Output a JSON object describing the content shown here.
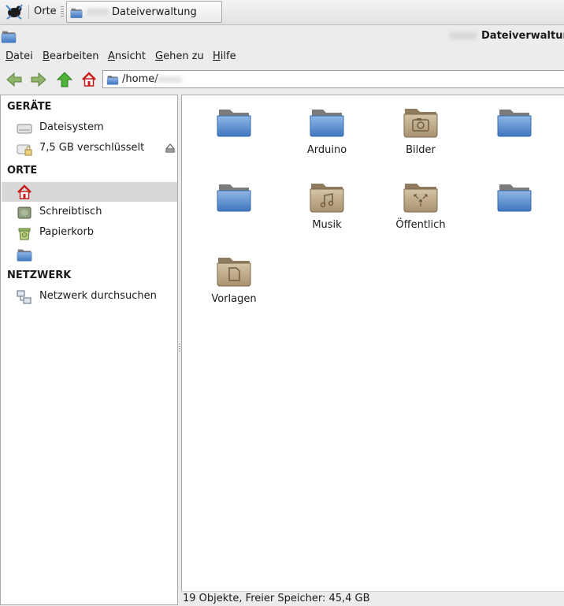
{
  "panel": {
    "places_label": "Orte",
    "task_title": "Dateiverwaltung"
  },
  "window": {
    "title": "Dateiverwaltun"
  },
  "menu": {
    "items": [
      "Datei",
      "Bearbeiten",
      "Ansicht",
      "Gehen zu",
      "Hilfe"
    ]
  },
  "toolbar": {
    "path": "/home/"
  },
  "sidebar": {
    "sections": {
      "devices": "GERÄTE",
      "places": "ORTE",
      "network": "NETZWERK"
    },
    "items": {
      "filesystem": "Dateisystem",
      "encrypted": "7,5 GB verschlüsselt",
      "home": "",
      "desktop": "Schreibtisch",
      "trash": "Papierkorb",
      "folder": "",
      "network": "Netzwerk durchsuchen"
    }
  },
  "files": [
    {
      "name": "",
      "icon": "folder-blue-icon"
    },
    {
      "name": "Arduino",
      "icon": "folder-blue-icon"
    },
    {
      "name": "Bilder",
      "icon": "folder-pictures-icon"
    },
    {
      "name": "",
      "icon": "folder-blue-icon"
    },
    {
      "name": "",
      "icon": "folder-blue-icon"
    },
    {
      "name": "Musik",
      "icon": "folder-music-icon"
    },
    {
      "name": "Öffentlich",
      "icon": "folder-public-icon"
    },
    {
      "name": "",
      "icon": "folder-blue-icon"
    },
    {
      "name": "Vorlagen",
      "icon": "folder-templates-icon"
    }
  ],
  "status": {
    "text": "19 Objekte, Freier Speicher: 45,4 GB"
  },
  "colors": {
    "annotation_arrow": "#e8171b",
    "folder_blue": "#5a8fd0",
    "folder_brown": "#b09a7a"
  }
}
